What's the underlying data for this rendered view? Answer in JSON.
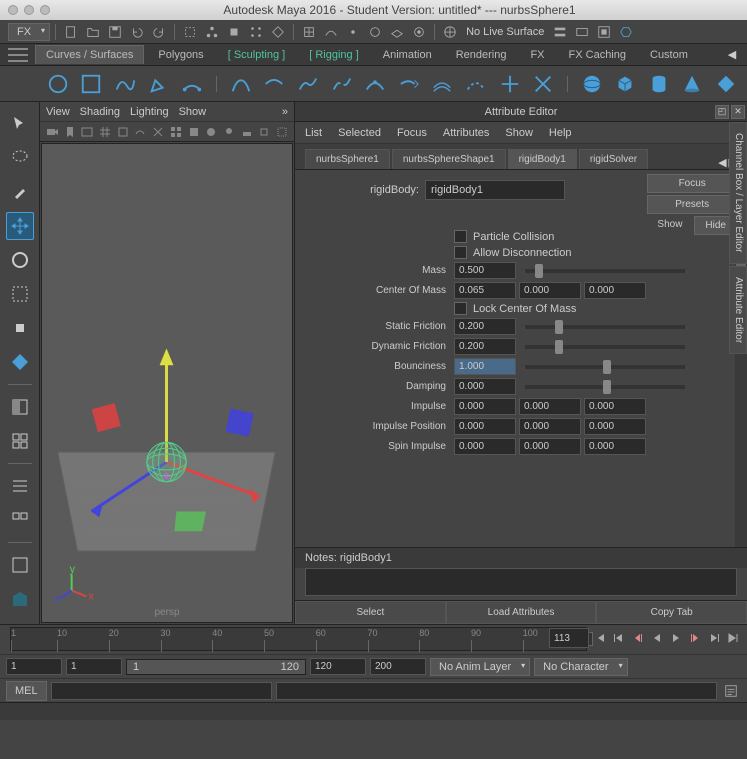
{
  "title": "Autodesk Maya 2016 - Student Version: untitled*  ---   nurbsSphere1",
  "workspace_dropdown": "FX",
  "status_line_text": "No Live Surface",
  "shelf_tabs": [
    "Curves / Surfaces",
    "Polygons",
    "Sculpting",
    "Rigging",
    "Animation",
    "Rendering",
    "FX",
    "FX Caching",
    "Custom"
  ],
  "shelf_active_idx": 0,
  "shelf_bracketed_idx": [
    2,
    3
  ],
  "viewport": {
    "menus": [
      "View",
      "Shading",
      "Lighting",
      "Show"
    ],
    "label": "persp"
  },
  "attr_editor": {
    "title": "Attribute Editor",
    "menus": [
      "List",
      "Selected",
      "Focus",
      "Attributes",
      "Show",
      "Help"
    ],
    "tabs": [
      "nurbsSphere1",
      "nurbsSphereShape1",
      "rigidBody1",
      "rigidSolver"
    ],
    "active_tab_idx": 2,
    "node_label": "rigidBody:",
    "node_name": "rigidBody1",
    "side_buttons": [
      "Focus",
      "Presets"
    ],
    "show_label": "Show",
    "hide_label": "Hide",
    "checkbox_particle_collision": "Particle Collision",
    "checkbox_allow_disconnection": "Allow Disconnection",
    "mass_label": "Mass",
    "mass": "0.500",
    "center_mass_label": "Center Of Mass",
    "center_mass": [
      "0.065",
      "0.000",
      "0.000"
    ],
    "lock_center_label": "Lock Center Of Mass",
    "static_friction_label": "Static Friction",
    "static_friction": "0.200",
    "dynamic_friction_label": "Dynamic Friction",
    "dynamic_friction": "0.200",
    "bounciness_label": "Bounciness",
    "bounciness": "1.000",
    "damping_label": "Damping",
    "damping": "0.000",
    "impulse_label": "Impulse",
    "impulse": [
      "0.000",
      "0.000",
      "0.000"
    ],
    "impulse_pos_label": "Impulse Position",
    "impulse_pos": [
      "0.000",
      "0.000",
      "0.000"
    ],
    "spin_impulse_label": "Spin Impulse",
    "spin_impulse": [
      "0.000",
      "0.000",
      "0.000"
    ],
    "notes_label": "Notes: rigidBody1",
    "bottom_buttons": [
      "Select",
      "Load Attributes",
      "Copy Tab"
    ]
  },
  "right_tabs": [
    "Channel Box / Layer Editor",
    "Attribute Editor"
  ],
  "timeline": {
    "ticks": [
      1,
      10,
      20,
      30,
      40,
      50,
      60,
      70,
      80,
      90,
      100,
      113
    ],
    "current_frame_box": "113",
    "current_frame_display": "113"
  },
  "range": {
    "start_outer": "1",
    "start_inner": "1",
    "slider_start": "1",
    "slider_end": "120",
    "end_inner": "120",
    "end_outer": "200",
    "anim_layer": "No Anim Layer",
    "character": "No Character"
  },
  "cmd": {
    "label": "MEL"
  }
}
